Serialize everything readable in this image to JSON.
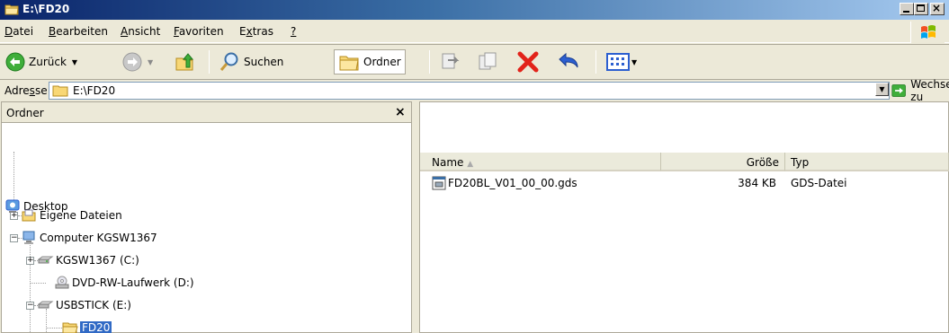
{
  "window": {
    "title": "E:\\FD20"
  },
  "menu": {
    "items": [
      {
        "pre": "",
        "u": "D",
        "post": "atei"
      },
      {
        "pre": "",
        "u": "B",
        "post": "earbeiten"
      },
      {
        "pre": "",
        "u": "A",
        "post": "nsicht"
      },
      {
        "pre": "",
        "u": "F",
        "post": "avoriten"
      },
      {
        "pre": "E",
        "u": "x",
        "post": "tras"
      },
      {
        "pre": "",
        "u": "?",
        "post": ""
      }
    ]
  },
  "toolbar": {
    "back_label": "Zurück",
    "search_label": "Suchen",
    "folders_label": "Ordner"
  },
  "address": {
    "label_pre": "Adre",
    "label_u": "s",
    "label_post": "se",
    "value": "E:\\FD20",
    "go_label": "Wechseln zu"
  },
  "folder_pane": {
    "title": "Ordner",
    "close": "×",
    "tree": [
      {
        "label": "Desktop",
        "icon": "desktop-icon"
      },
      {
        "label": "Eigene Dateien",
        "icon": "documents-folder-icon"
      },
      {
        "label": "Computer KGSW1367",
        "icon": "computer-icon"
      },
      {
        "label": "KGSW1367 (C:)",
        "icon": "hard-drive-icon"
      },
      {
        "label": "DVD-RW-Laufwerk (D:)",
        "icon": "dvd-drive-icon"
      },
      {
        "label": "USBSTICK (E:)",
        "icon": "removable-drive-icon"
      },
      {
        "label": "FD20",
        "icon": "open-folder-icon",
        "selected": true
      }
    ]
  },
  "file_list": {
    "columns": [
      "Name",
      "Größe",
      "Typ"
    ],
    "sort_indicator": "▲",
    "rows": [
      {
        "name": "FD20BL_V01_00_00.gds",
        "size": "384 KB",
        "type": "GDS-Datei"
      }
    ]
  },
  "colors": {
    "title_gradient_start": "#0A246A",
    "title_gradient_end": "#A6CAF0",
    "selection": "#316AC5",
    "chrome": "#ECE9D8"
  }
}
